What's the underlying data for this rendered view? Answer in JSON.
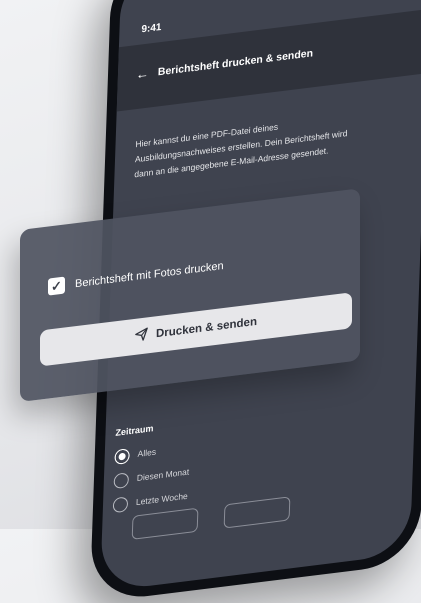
{
  "status_bar": {
    "time": "9:41",
    "icons": "▂▄▆ ◠ ▬"
  },
  "header": {
    "back_icon": "←",
    "title": "Berichtsheft drucken & senden"
  },
  "description": "Hier kannst du eine PDF-Datei deines Ausbildungsnachweises erstellen. Dein Berichtsheft wird dann an die angegebene E-Mail-Adresse gesendet.",
  "overlay": {
    "checkbox_label": "Berichtsheft mit Fotos drucken",
    "checkbox_checked": true,
    "send_button_label": "Drucken & senden",
    "send_icon": "send-icon"
  },
  "zeitraum": {
    "label": "Zeitraum",
    "options": [
      "Alles",
      "Diesen Monat",
      "Letzte Woche"
    ],
    "selected": "Alles"
  },
  "colors": {
    "background": "#eceef1",
    "screen": "#3f434f",
    "header": "#2f323b",
    "overlay": "#505461",
    "button": "#e7e7ea"
  }
}
